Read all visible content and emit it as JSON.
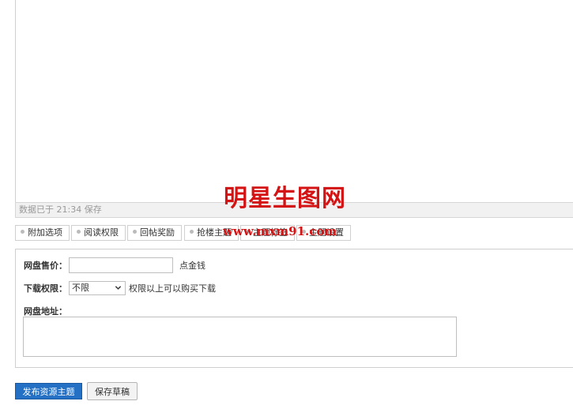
{
  "editor": {
    "status": "数据已于 21:34 保存"
  },
  "tabs": [
    {
      "label": "附加选项"
    },
    {
      "label": "阅读权限"
    },
    {
      "label": "回帖奖励"
    },
    {
      "label": "抢楼主题"
    },
    {
      "label": "主题标签"
    },
    {
      "label": "主题设置"
    }
  ],
  "form": {
    "price": {
      "label": "网盘售价：",
      "value": "",
      "unit": "点金钱"
    },
    "download": {
      "label": "下载权限：",
      "selected": "不限",
      "hint": "权限以上可以购买下载"
    },
    "address": {
      "label": "网盘地址：",
      "value": ""
    }
  },
  "buttons": {
    "publish": "发布资源主题",
    "save_draft": "保存草稿"
  },
  "watermark": {
    "title": "明星生图网",
    "url": "www.mxm91.com"
  },
  "colors": {
    "primary": "#2370c4",
    "watermark": "#d41414"
  },
  "icons": {
    "tab_bullet": "bullet-icon",
    "select_arrow": "chevron-down-icon"
  }
}
